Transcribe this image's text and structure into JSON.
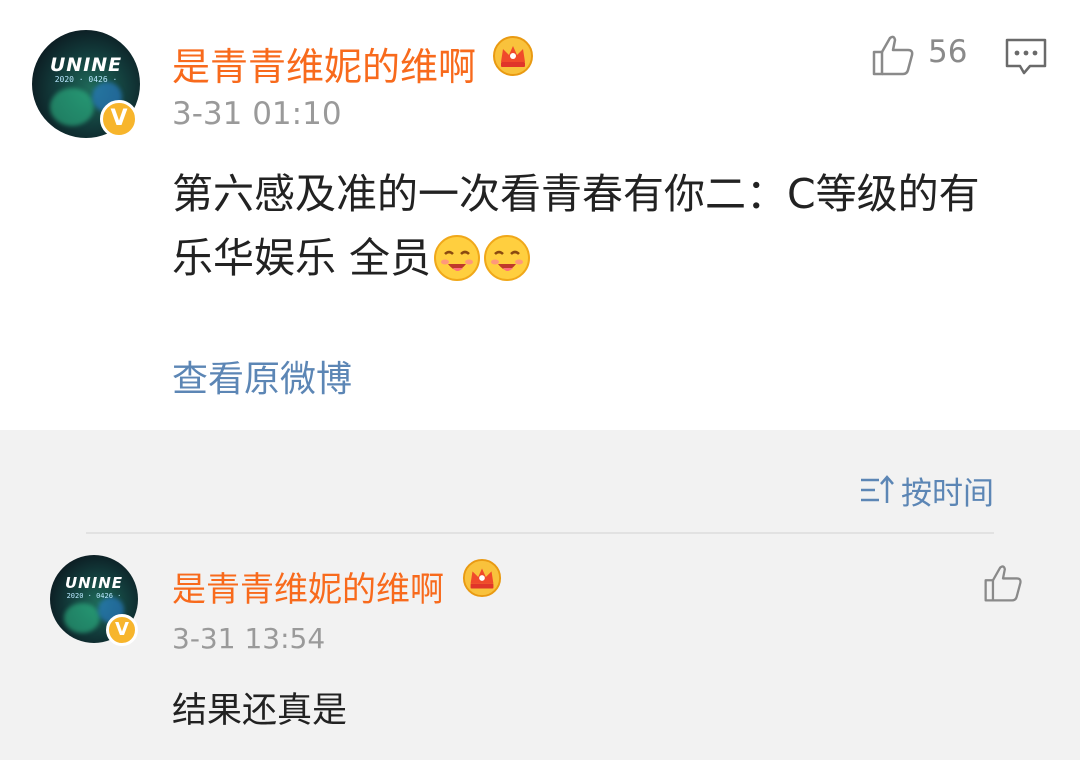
{
  "comment": {
    "avatar": {
      "brand": "UNINE",
      "date": "2020 · 0426 ·",
      "icon": "avatar-image"
    },
    "verified_badge": "V",
    "username": "是青青维妮的维啊",
    "crown_icon": "crown-icon",
    "time": "3-31 01:10",
    "text_line1": "第六感及准的一次看青春有你二：C等级的有",
    "text_line2": "乐华娱乐  全员",
    "emoji": [
      "drooling-face-emoji",
      "drooling-face-emoji"
    ],
    "like_count": "56",
    "like_icon": "thumbs-up-icon",
    "reply_icon": "comment-icon",
    "view_original": "查看原微博"
  },
  "sort": {
    "label": "按时间",
    "icon": "sort-time-icon"
  },
  "reply": {
    "avatar": {
      "brand": "UNINE",
      "date": "2020 · 0426 ·"
    },
    "verified_badge": "V",
    "username": "是青青维妮的维啊",
    "crown_icon": "crown-icon",
    "time": "3-31 13:54",
    "text": "结果还真是",
    "like_icon": "thumbs-up-icon"
  },
  "colors": {
    "username": "#f86a1c",
    "link": "#5c86b5",
    "meta": "#9a9a9a",
    "badge": "#f7b52c",
    "reply_bg": "#f2f2f2"
  }
}
